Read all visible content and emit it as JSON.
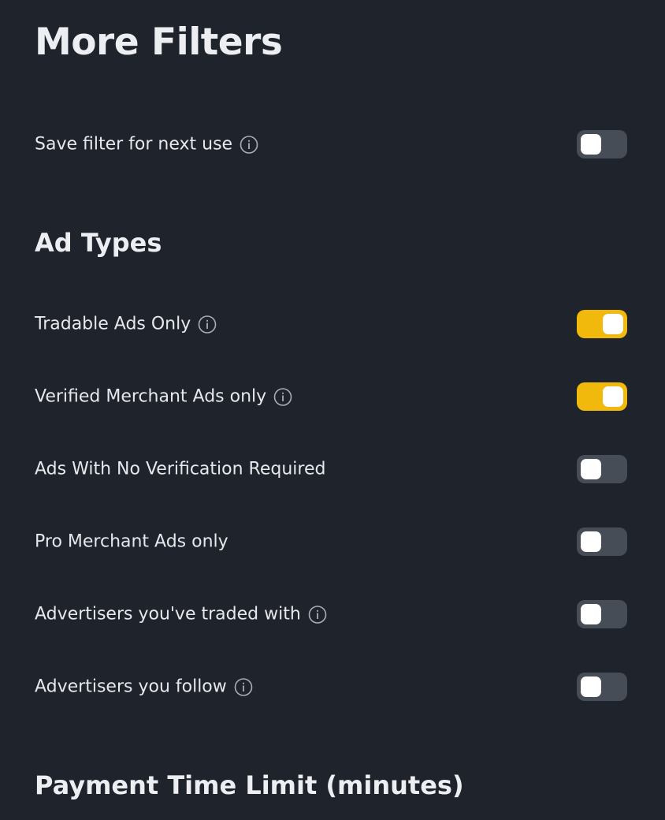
{
  "page_title": "More Filters",
  "save_filter": {
    "label": "Save filter for next use",
    "enabled": false,
    "has_info": true
  },
  "ad_types": {
    "heading": "Ad Types",
    "items": [
      {
        "label": "Tradable Ads Only",
        "enabled": true,
        "has_info": true
      },
      {
        "label": "Verified Merchant Ads only",
        "enabled": true,
        "has_info": true
      },
      {
        "label": "Ads With No Verification Required",
        "enabled": false,
        "has_info": false
      },
      {
        "label": "Pro Merchant Ads only",
        "enabled": false,
        "has_info": false
      },
      {
        "label": "Advertisers you've traded with",
        "enabled": false,
        "has_info": true
      },
      {
        "label": "Advertisers you follow",
        "enabled": false,
        "has_info": true
      }
    ]
  },
  "payment_time_limit": {
    "heading": "Payment Time Limit (minutes)"
  },
  "colors": {
    "background": "#1f232b",
    "toggle_on": "#f0b90b",
    "toggle_off": "#474d57",
    "text": "#e6e8ec"
  },
  "icons": {
    "info": "info-circle-icon"
  }
}
